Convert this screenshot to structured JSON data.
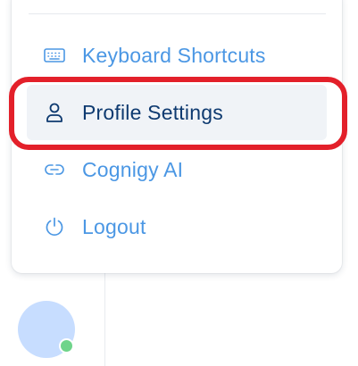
{
  "menu": {
    "items": [
      {
        "label": "Keyboard Shortcuts",
        "icon": "keyboard-icon",
        "active": false
      },
      {
        "label": "Profile Settings",
        "icon": "user-icon",
        "active": true
      },
      {
        "label": "Cognigy AI",
        "icon": "link-icon",
        "active": false
      },
      {
        "label": "Logout",
        "icon": "power-icon",
        "active": false
      }
    ]
  },
  "colors": {
    "item_text": "#4b97e4",
    "active_text": "#0e3a70",
    "active_bg": "#f0f3f7",
    "highlight_border": "#e3202a",
    "avatar_bg": "#c7ddff",
    "status_online": "#6fd48a"
  },
  "user": {
    "status": "online"
  }
}
